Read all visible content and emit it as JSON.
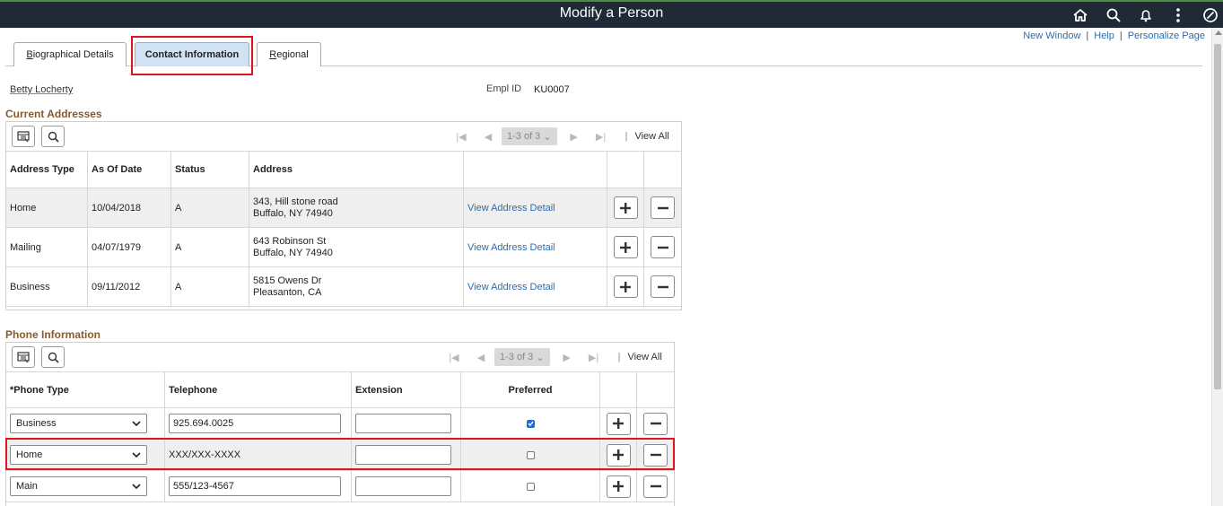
{
  "header": {
    "title": "Modify a Person",
    "links": [
      "New Window",
      "Help",
      "Personalize Page"
    ]
  },
  "tabs": [
    {
      "label": "Biographical Details",
      "active": false
    },
    {
      "label": "Contact Information",
      "active": true
    },
    {
      "label": "Regional",
      "active": false
    }
  ],
  "person": {
    "name": "Betty Locherty",
    "empl_id_label": "Empl ID",
    "empl_id": "KU0007"
  },
  "addresses": {
    "title": "Current Addresses",
    "pager": {
      "range": "1-3 of 3",
      "view_all": "View All"
    },
    "columns": [
      "Address Type",
      "As Of Date",
      "Status",
      "Address"
    ],
    "rows": [
      {
        "type": "Home",
        "date": "10/04/2018",
        "status": "A",
        "line1": "343, Hill stone road",
        "line2": "Buffalo, NY 74940",
        "link": "View Address Detail"
      },
      {
        "type": "Mailing",
        "date": "04/07/1979",
        "status": "A",
        "line1": "643 Robinson St",
        "line2": "Buffalo, NY 74940",
        "link": "View Address Detail"
      },
      {
        "type": "Business",
        "date": "09/11/2012",
        "status": "A",
        "line1": "5815 Owens Dr",
        "line2": "Pleasanton, CA",
        "link": "View Address Detail"
      }
    ]
  },
  "phones": {
    "title": "Phone Information",
    "pager": {
      "range": "1-3 of 3",
      "view_all": "View All"
    },
    "columns": [
      "*Phone Type",
      "Telephone",
      "Extension",
      "Preferred"
    ],
    "rows": [
      {
        "type": "Business",
        "telephone": "925.694.0025",
        "extension": "",
        "preferred": true
      },
      {
        "type": "Home",
        "telephone": "XXX/XXX-XXXX",
        "extension": "",
        "preferred": false
      },
      {
        "type": "Main",
        "telephone": "555/123-4567",
        "extension": "",
        "preferred": false
      }
    ]
  },
  "colors": {
    "banner": "#1f2a36",
    "active_tab": "#cfe3f5",
    "section_title": "#8a5a2b",
    "link": "#2b6cb0",
    "highlight": "#e0141e"
  }
}
